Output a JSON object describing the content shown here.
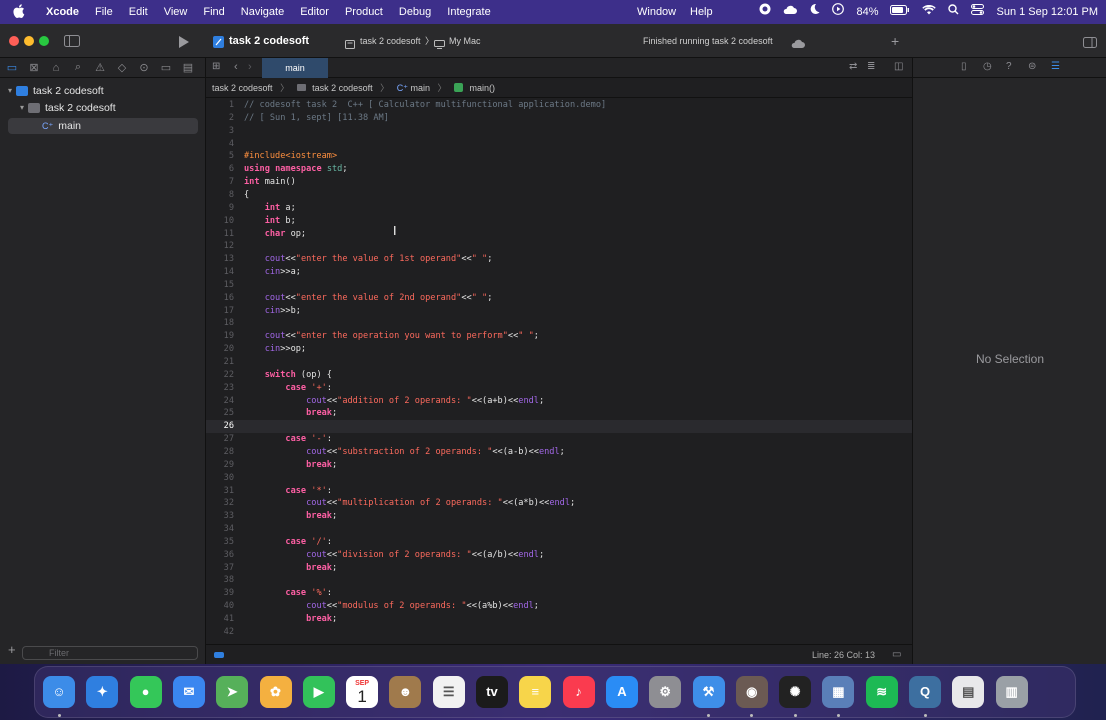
{
  "menubar": {
    "app_name": "Xcode",
    "items": [
      "File",
      "Edit",
      "View",
      "Find",
      "Navigate",
      "Editor",
      "Product",
      "Debug",
      "Integrate"
    ],
    "window_menu": "Window",
    "help_menu": "Help",
    "battery": "84%",
    "clock": "Sun 1 Sep  12:01 PM"
  },
  "titlebar": {
    "project": "task 2 codesoft",
    "scheme": "task 2 codesoft",
    "destination": "My Mac",
    "status": "Finished running task 2 codesoft"
  },
  "navigator": {
    "project": "task 2 codesoft",
    "folder": "task 2 codesoft",
    "file": "main",
    "filter_placeholder": "Filter"
  },
  "editor": {
    "tab": "main",
    "jump": {
      "project": "task 2 codesoft",
      "folder": "task 2 codesoft",
      "file": "main",
      "symbol": "main()"
    },
    "current_line": 26,
    "status": "Line: 26  Col: 13"
  },
  "code_lines": [
    "// codesoft task 2  C++ [ Calculator multifunctional application.demo]",
    "// [ Sun 1, sept] [11.38 AM]",
    "",
    "",
    "#include<iostream>",
    "using namespace std;",
    "int main()",
    "{",
    "    int a;",
    "    int b;",
    "    char op;",
    "",
    "    cout<<\"enter the value of 1st operand\"<<\" \";",
    "    cin>>a;",
    "",
    "    cout<<\"enter the value of 2nd operand\"<<\" \";",
    "    cin>>b;",
    "",
    "    cout<<\"enter the operation you want to perform\"<<\" \";",
    "    cin>>op;",
    "",
    "    switch (op) {",
    "        case '+':",
    "            cout<<\"addition of 2 operands: \"<<(a+b)<<endl;",
    "            break;",
    "",
    "        case '-':",
    "            cout<<\"substraction of 2 operands: \"<<(a-b)<<endl;",
    "            break;",
    "",
    "        case '*':",
    "            cout<<\"multiplication of 2 operands: \"<<(a*b)<<endl;",
    "            break;",
    "",
    "        case '/':",
    "            cout<<\"division of 2 operands: \"<<(a/b)<<endl;",
    "            break;",
    "",
    "        case '%':",
    "            cout<<\"modulus of 2 operands: \"<<(a%b)<<endl;",
    "            break;",
    ""
  ],
  "inspector": {
    "empty_text": "No Selection"
  },
  "dock": {
    "apps": [
      {
        "icon": "finder-icon",
        "color": "#3c8ce8"
      },
      {
        "icon": "safari-icon",
        "color": "#2f7fe0"
      },
      {
        "icon": "messages-icon",
        "color": "#34c759"
      },
      {
        "icon": "mail-icon",
        "color": "#3a86f0"
      },
      {
        "icon": "maps-icon",
        "color": "#56b05a"
      },
      {
        "icon": "photos-icon",
        "color": "#f4b040"
      },
      {
        "icon": "facetime-icon",
        "color": "#32c25a"
      },
      {
        "icon": "calendar-icon",
        "color": "#ffffff"
      },
      {
        "icon": "contacts-icon",
        "color": "#a07a4c"
      },
      {
        "icon": "reminders-icon",
        "color": "#f2f2f2"
      },
      {
        "icon": "tv-icon",
        "color": "#1b1b1b"
      },
      {
        "icon": "notes-icon",
        "color": "#f7d54a"
      },
      {
        "icon": "music-icon",
        "color": "#fa3b4f"
      },
      {
        "icon": "app-store-icon",
        "color": "#2a8cf5"
      },
      {
        "icon": "settings-icon",
        "color": "#8e8e93"
      },
      {
        "icon": "xcode-icon",
        "color": "#3e8ee8"
      },
      {
        "icon": "instruments-icon",
        "color": "#6b5a53"
      },
      {
        "icon": "chatgpt-icon",
        "color": "#222222"
      },
      {
        "icon": "preview-icon",
        "color": "#5a7fb8"
      },
      {
        "icon": "spotify-icon",
        "color": "#1db954"
      },
      {
        "icon": "quicktime-icon",
        "color": "#3d6fa0"
      },
      {
        "icon": "downloads-icon",
        "color": "#e8e8ea"
      },
      {
        "icon": "trash-icon",
        "color": "#9aa0a6"
      }
    ],
    "calendar": {
      "month": "SEP",
      "day": "1"
    },
    "tv_label": "tv"
  }
}
